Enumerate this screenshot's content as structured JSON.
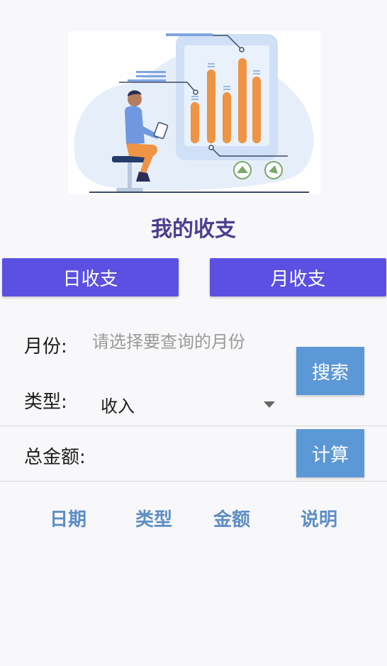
{
  "page_title": "我的收支",
  "tabs": {
    "daily": "日收支",
    "monthly": "月收支"
  },
  "form": {
    "month_label": "月份:",
    "month_placeholder": "请选择要查询的月份",
    "type_label": "类型:",
    "type_value": "收入",
    "total_label": "总金额:"
  },
  "buttons": {
    "search": "搜索",
    "calculate": "计算"
  },
  "table_headers": [
    "日期",
    "类型",
    "金额",
    "说明"
  ],
  "colors": {
    "tab_button": "#5b50e1",
    "action_button": "#5d98d6",
    "title": "#4b3f8f",
    "column_header": "#5d8ec4",
    "chart_bar": "#ee9444"
  }
}
